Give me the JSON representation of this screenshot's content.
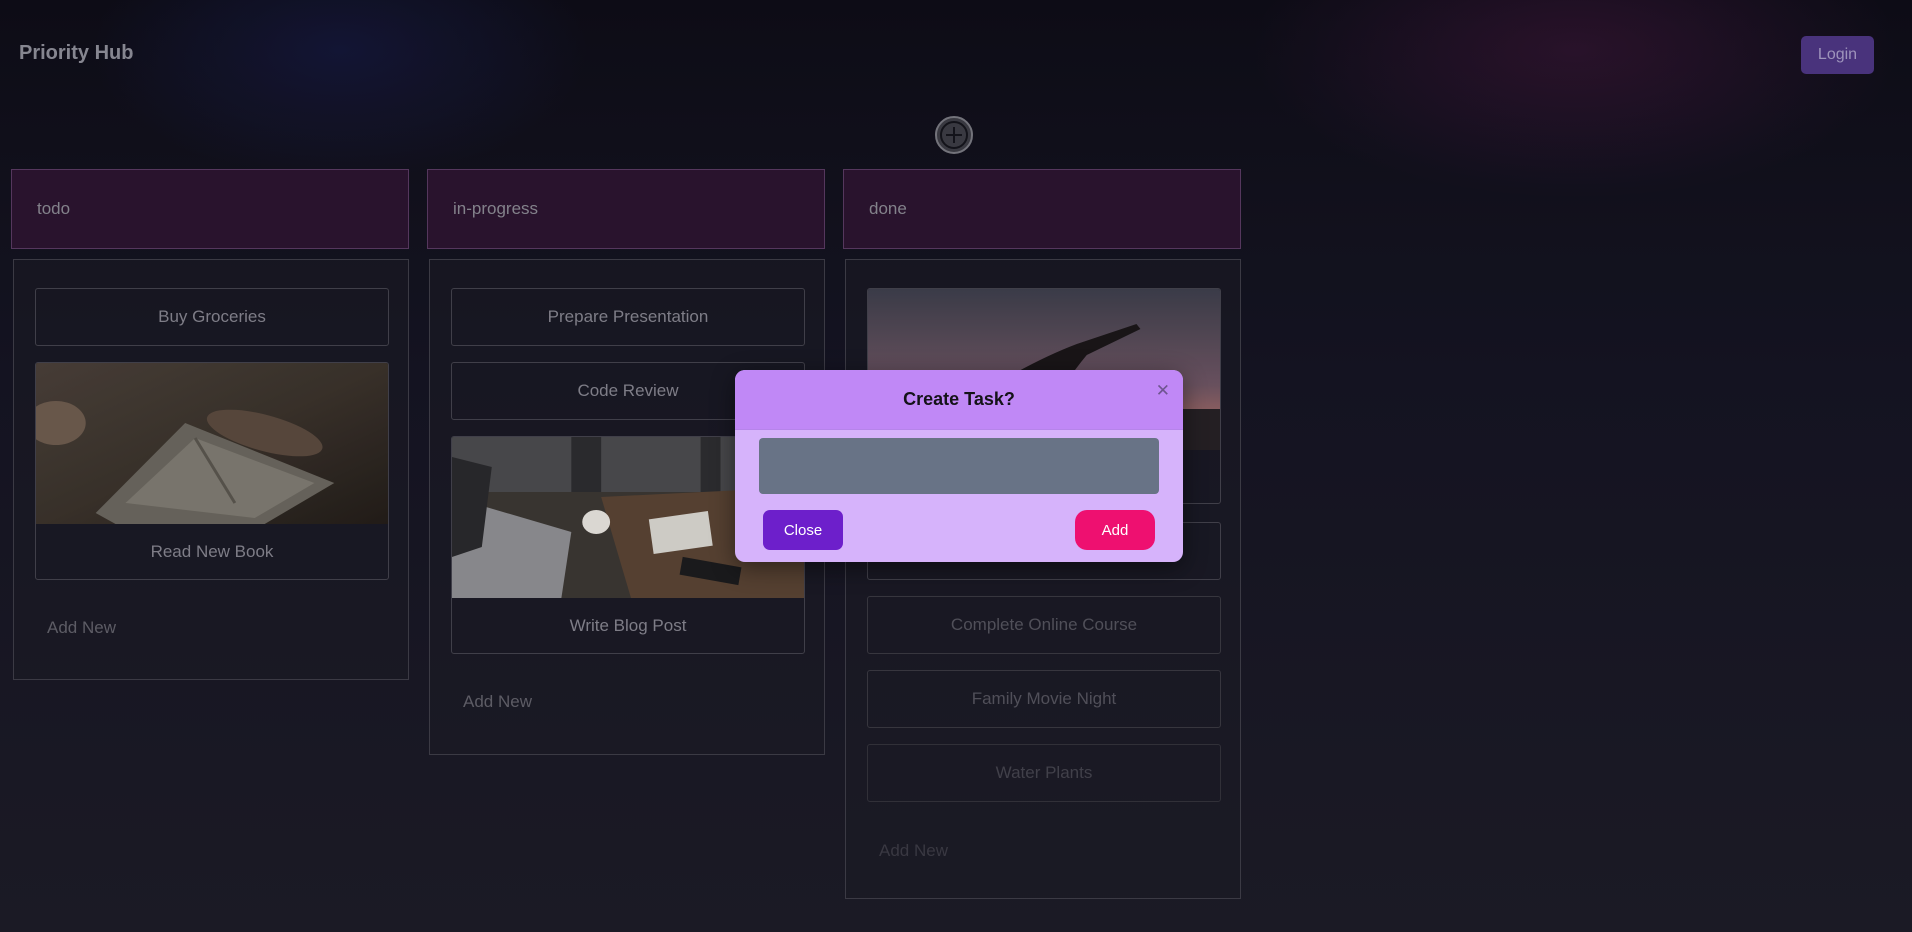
{
  "app": {
    "title": "Priority Hub"
  },
  "header": {
    "login_label": "Login"
  },
  "toolbar": {
    "add_task_icon": "plus-circle-icon"
  },
  "columns": [
    {
      "title": "todo",
      "cards": [
        {
          "label": "Buy Groceries",
          "has_image": false
        },
        {
          "label": "Read New Book",
          "has_image": true,
          "image": "book-photo"
        }
      ],
      "add_new_label": "Add New"
    },
    {
      "title": "in-progress",
      "cards": [
        {
          "label": "Prepare Presentation",
          "has_image": false
        },
        {
          "label": "Code Review",
          "has_image": false
        },
        {
          "label": "Write Blog Post",
          "has_image": true,
          "image": "laptop-desk-photo"
        }
      ],
      "add_new_label": "Add New"
    },
    {
      "title": "done",
      "cards": [
        {
          "label": "",
          "has_image": true,
          "image": "sunset-silhouette-photo"
        },
        {
          "label": "",
          "has_image": false
        },
        {
          "label": "Complete Online Course",
          "has_image": false
        },
        {
          "label": "Family Movie Night",
          "has_image": false
        },
        {
          "label": "Water Plants",
          "has_image": false
        }
      ],
      "add_new_label": "Add New"
    }
  ],
  "modal": {
    "title": "Create Task?",
    "close_icon": "close-icon",
    "input_value": "",
    "close_label": "Close",
    "add_label": "Add"
  },
  "colors": {
    "column_header_bg": "#2c1530",
    "modal_header": "#c088f6",
    "modal_body": "#d6b3fb",
    "close_button": "#6d1fcb",
    "add_button": "#ee1070",
    "login_button": "#4d3683"
  }
}
